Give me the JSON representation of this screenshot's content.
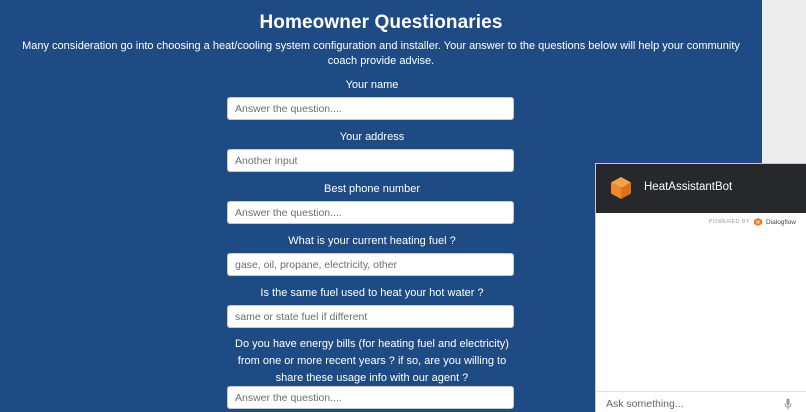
{
  "page": {
    "title": "Homeowner Questionaries",
    "intro": "Many consideration go into choosing a heat/cooling system configuration and installer. Your answer to the questions below will help your community coach provide advise."
  },
  "questions": [
    {
      "label": "Your name",
      "placeholder": "Answer the question...."
    },
    {
      "label": "Your address",
      "placeholder": "Another input"
    },
    {
      "label": "Best phone number",
      "placeholder": "Answer the question...."
    },
    {
      "label": "What is your current heating fuel ?",
      "placeholder": "gase, oil, propane, electricity, other"
    },
    {
      "label": "Is the same fuel used to heat your hot water ?",
      "placeholder": "same or state fuel if different"
    },
    {
      "label": "Do you have energy bills (for heating fuel and electricity) from one or more recent years ? if so, are you willing to share these usage info with our agent ?",
      "placeholder": "Answer the question...."
    }
  ],
  "chat": {
    "bot_name": "HeatAssistantBot",
    "powered_by": "POWERED BY",
    "provider": "Dialogflow",
    "input_placeholder": "Ask something..."
  },
  "colors": {
    "background": "#1f4b85",
    "chat_header": "#27282c",
    "bot_logo": "#ef8a2a",
    "provider_logo": "#ef7b22"
  },
  "icons": {
    "bot_logo": "cube-icon",
    "provider_logo": "dialogflow-icon",
    "mic": "microphone-icon"
  }
}
